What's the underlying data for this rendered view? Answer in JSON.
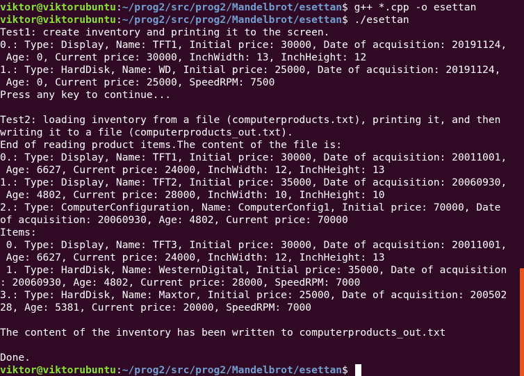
{
  "prompts": [
    {
      "user": "viktor@viktorubuntu",
      "sep": ":",
      "path": "~/prog2/src/prog2/Mandelbrot/esettan",
      "symbol": "$",
      "command": " g++ *.cpp -o esettan"
    },
    {
      "user": "viktor@viktorubuntu",
      "sep": ":",
      "path": "~/prog2/src/prog2/Mandelbrot/esettan",
      "symbol": "$",
      "command": " ./esettan"
    },
    {
      "user": "viktor@viktorubuntu",
      "sep": ":",
      "path": "~/prog2/src/prog2/Mandelbrot/esettan",
      "symbol": "$",
      "command": " "
    }
  ],
  "output": [
    "Test1: create inventory and printing it to the screen.",
    "0.: Type: Display, Name: TFT1, Initial price: 30000, Date of acquisition: 20191124,",
    " Age: 0, Current price: 30000, InchWidth: 13, InchHeight: 12",
    "1.: Type: HardDisk, Name: WD, Initial price: 25000, Date of acquisition: 20191124,",
    " Age: 0, Current price: 25000, SpeedRPM: 7500",
    "Press any key to continue...",
    "",
    "Test2: loading inventory from a file (computerproducts.txt), printing it, and then",
    "writing it to a file (computerproducts_out.txt).",
    "End of reading product items.The content of the file is:",
    "0.: Type: Display, Name: TFT1, Initial price: 30000, Date of acquisition: 20011001,",
    " Age: 6627, Current price: 24000, InchWidth: 12, InchHeight: 13",
    "1.: Type: Display, Name: TFT2, Initial price: 35000, Date of acquisition: 20060930,",
    " Age: 4802, Current price: 28000, InchWidth: 10, InchHeight: 10",
    "2.: Type: ComputerConfiguration, Name: ComputerConfig1, Initial price: 70000, Date",
    "of acquisition: 20060930, Age: 4802, Current price: 70000",
    "Items:",
    " 0. Type: Display, Name: TFT3, Initial price: 30000, Date of acquisition: 20011001,",
    " Age: 6627, Current price: 24000, InchWidth: 12, InchHeight: 13",
    " 1. Type: HardDisk, Name: WesternDigital, Initial price: 35000, Date of acquisition",
    ": 20060930, Age: 4802, Current price: 28000, SpeedRPM: 7000",
    "3.: Type: HardDisk, Name: Maxtor, Initial price: 25000, Date of acquisition: 200502",
    "28, Age: 5381, Current price: 20000, SpeedRPM: 7000",
    "",
    "The content of the inventory has been written to computerproducts_out.txt",
    "",
    "Done."
  ],
  "colors": {
    "background": "#300a24",
    "user": "#8ae234",
    "path": "#729fcf",
    "text": "#ffffff",
    "scrollbar": "#e95420"
  }
}
